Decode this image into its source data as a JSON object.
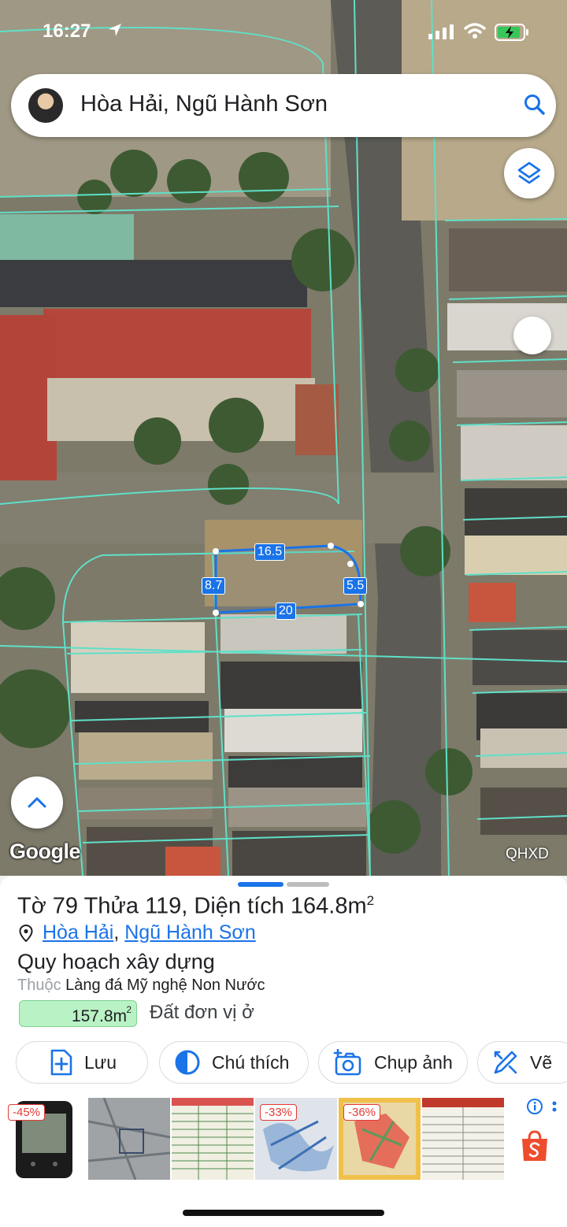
{
  "status_bar": {
    "time": "16:27"
  },
  "search": {
    "query": "Hòa Hải, Ngũ Hành Sơn"
  },
  "map": {
    "logo": "Google",
    "layer_badge": "QHXD",
    "measurements": {
      "top": "16.5",
      "left": "8.7",
      "right": "5.5",
      "bottom": "20"
    },
    "icons": [
      "layers-icon",
      "compass-icon",
      "chevron-up-icon",
      "search-icon",
      "location-arrow-icon"
    ]
  },
  "parcel": {
    "title_prefix": "Tờ",
    "sheet_no": "79",
    "parcel_label": "Thửa",
    "parcel_no": "119",
    "area_label": ", Diện tích",
    "area_value": "164.8m",
    "area_sup": "2",
    "ward": "Hòa Hải",
    "separator": ",",
    "district": "Ngũ Hành Sơn"
  },
  "planning": {
    "title": "Quy hoạch xây dựng",
    "belongs_label": "Thuộc",
    "belongs_value": "Làng đá Mỹ nghệ Non Nước",
    "chip_value": "157.8m",
    "chip_sup": "2",
    "chip_color": "#b9f2c4",
    "land_type": "Đất đơn vị ở"
  },
  "actions": {
    "save": "Lưu",
    "legend": "Chú thích",
    "photo": "Chụp ảnh",
    "draw": "Vẽ"
  },
  "ads": {
    "discounts": [
      "-45%",
      "-33%",
      "-36%"
    ],
    "brand_color": "#ee4d2d"
  },
  "colors": {
    "accent": "#1a73e8",
    "parcel_lines": "#5fe0c8"
  }
}
